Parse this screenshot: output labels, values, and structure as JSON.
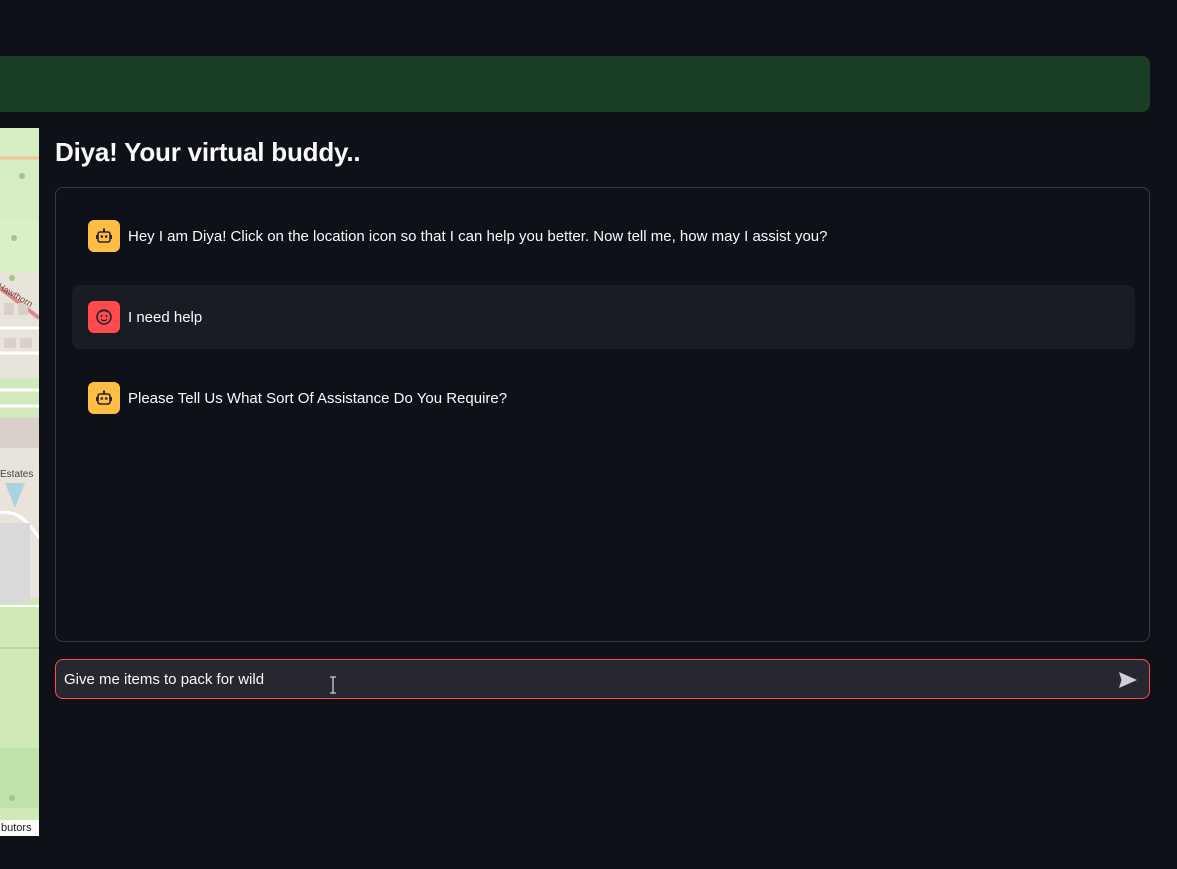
{
  "header": {
    "banner_color": "#1a3d25"
  },
  "title": "Diya! Your virtual buddy..",
  "chat": {
    "messages": [
      {
        "role": "assistant",
        "avatar_icon": "robot-icon",
        "text": "Hey I am Diya! Click on the location icon so that I can help you better. Now tell me, how may I assist you?"
      },
      {
        "role": "user",
        "avatar_icon": "smiley-face-icon",
        "text": "I need help"
      },
      {
        "role": "assistant",
        "avatar_icon": "robot-icon",
        "text": "Please Tell Us What Sort Of Assistance Do You Require?"
      }
    ]
  },
  "input": {
    "value": "Give me items to pack for wild",
    "send_icon": "send-arrow-icon"
  },
  "map": {
    "labels": [
      "Hawthorn",
      "Estates"
    ],
    "attribution": "butors"
  },
  "colors": {
    "background": "#0e1117",
    "bot_avatar": "#ffbd45",
    "user_avatar": "#ff4b4b",
    "input_border": "#ff4b4b"
  }
}
